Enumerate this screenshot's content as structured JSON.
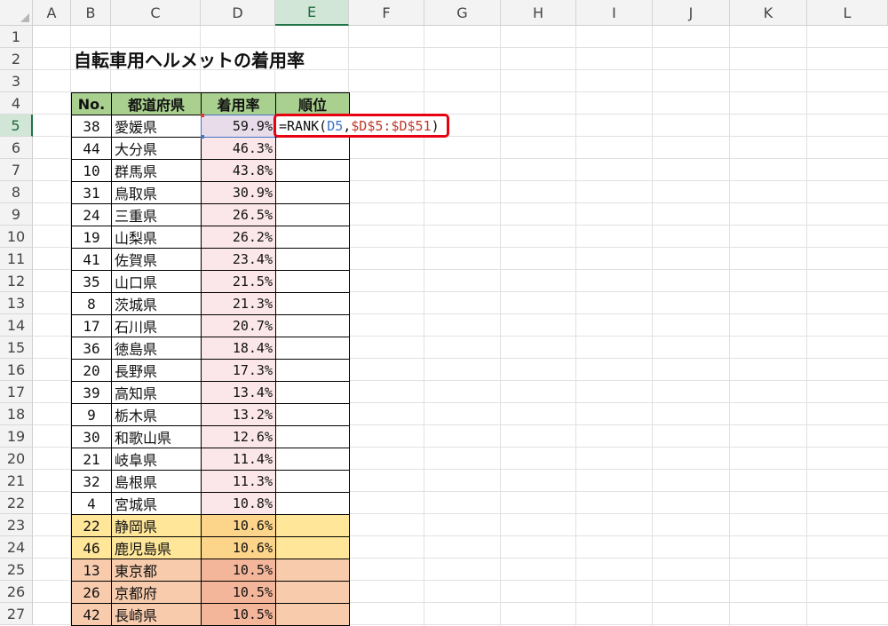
{
  "columns": [
    "A",
    "B",
    "C",
    "D",
    "E",
    "F",
    "G",
    "H",
    "I",
    "J",
    "K",
    "L"
  ],
  "rows": [
    "1",
    "2",
    "3",
    "4",
    "5",
    "6",
    "7",
    "8",
    "9",
    "10",
    "11",
    "12",
    "13",
    "14",
    "15",
    "16",
    "17",
    "18",
    "19",
    "20",
    "21",
    "22",
    "23",
    "24",
    "25",
    "26",
    "27"
  ],
  "selected_column": "E",
  "selected_row": "5",
  "title": "自転車用ヘルメットの着用率",
  "table": {
    "headers": [
      "No.",
      "都道府県",
      "着用率",
      "順位"
    ],
    "rows": [
      {
        "no": "38",
        "pref": "愛媛県",
        "rate": "59.9%",
        "rank": ""
      },
      {
        "no": "44",
        "pref": "大分県",
        "rate": "46.3%",
        "rank": ""
      },
      {
        "no": "10",
        "pref": "群馬県",
        "rate": "43.8%",
        "rank": ""
      },
      {
        "no": "31",
        "pref": "鳥取県",
        "rate": "30.9%",
        "rank": ""
      },
      {
        "no": "24",
        "pref": "三重県",
        "rate": "26.5%",
        "rank": ""
      },
      {
        "no": "19",
        "pref": "山梨県",
        "rate": "26.2%",
        "rank": ""
      },
      {
        "no": "41",
        "pref": "佐賀県",
        "rate": "23.4%",
        "rank": ""
      },
      {
        "no": "35",
        "pref": "山口県",
        "rate": "21.5%",
        "rank": ""
      },
      {
        "no": "8",
        "pref": "茨城県",
        "rate": "21.3%",
        "rank": ""
      },
      {
        "no": "17",
        "pref": "石川県",
        "rate": "20.7%",
        "rank": ""
      },
      {
        "no": "36",
        "pref": "徳島県",
        "rate": "18.4%",
        "rank": ""
      },
      {
        "no": "20",
        "pref": "長野県",
        "rate": "17.3%",
        "rank": ""
      },
      {
        "no": "39",
        "pref": "高知県",
        "rate": "13.4%",
        "rank": ""
      },
      {
        "no": "9",
        "pref": "栃木県",
        "rate": "13.2%",
        "rank": ""
      },
      {
        "no": "30",
        "pref": "和歌山県",
        "rate": "12.6%",
        "rank": ""
      },
      {
        "no": "21",
        "pref": "岐阜県",
        "rate": "11.4%",
        "rank": ""
      },
      {
        "no": "32",
        "pref": "島根県",
        "rate": "11.3%",
        "rank": ""
      },
      {
        "no": "4",
        "pref": "宮城県",
        "rate": "10.8%",
        "rank": ""
      },
      {
        "no": "22",
        "pref": "静岡県",
        "rate": "10.6%",
        "rank": ""
      },
      {
        "no": "46",
        "pref": "鹿児島県",
        "rate": "10.6%",
        "rank": ""
      },
      {
        "no": "13",
        "pref": "東京都",
        "rate": "10.5%",
        "rank": ""
      },
      {
        "no": "26",
        "pref": "京都府",
        "rate": "10.5%",
        "rank": ""
      },
      {
        "no": "42",
        "pref": "長崎県",
        "rate": "10.5%",
        "rank": ""
      }
    ]
  },
  "formula": {
    "prefix": "=RANK(",
    "ref1": "D5",
    "sep": ",",
    "ref2": "$D$5:$D$51",
    "suffix": ")"
  },
  "colors": {
    "header_fill": "#a9d08e",
    "rate_fill": "#fbe7ea",
    "yellow_fill": "#ffe699",
    "yellow_rate_fill": "#fcd48a",
    "orange_fill": "#f8cbad",
    "orange_rate_fill": "#f4b69a",
    "selection": "#217346",
    "formula_outline": "#e60012"
  }
}
